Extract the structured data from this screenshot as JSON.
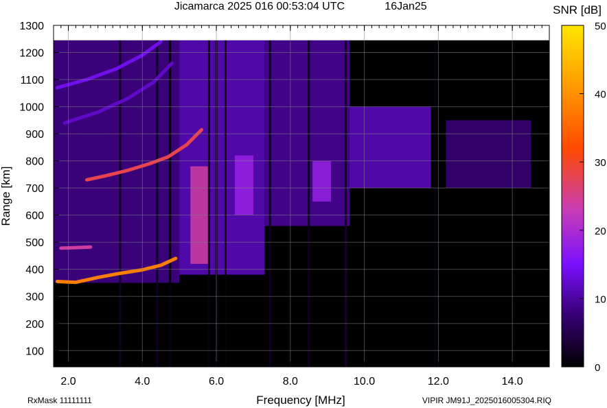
{
  "header": {
    "station_time": "Jicamarca 2025 016 00:53:04 UTC",
    "date": "16Jan25"
  },
  "footer": {
    "rxmask": "RxMask 11111111",
    "file": "VIPIR  JM91J_2025016005304.RIQ"
  },
  "chart_data": {
    "type": "heatmap",
    "xlabel": "Frequency [MHz]",
    "ylabel": "Range [km]",
    "xlim": [
      1.6,
      15.0
    ],
    "ylim": [
      40,
      1300
    ],
    "xticks": [
      2.0,
      4.0,
      6.0,
      8.0,
      10.0,
      12.0,
      14.0
    ],
    "xtick_labels": [
      "2.0",
      "4.0",
      "6.0",
      "8.0",
      "10.0",
      "12.0",
      "14.0"
    ],
    "yticks": [
      100,
      200,
      300,
      400,
      500,
      600,
      700,
      800,
      900,
      1000,
      1100,
      1200,
      1300
    ],
    "ytick_labels": [
      "100",
      "200",
      "300",
      "400",
      "500",
      "600",
      "700",
      "800",
      "900",
      "1000",
      "1100",
      "1200",
      "1300"
    ],
    "data_range_max_km": 1245,
    "grid": true,
    "colorbar": {
      "label": "SNR [dB]",
      "range": [
        0,
        50
      ],
      "ticks": [
        0,
        10,
        20,
        30,
        40,
        50
      ],
      "tick_labels": [
        "0",
        "10",
        "20",
        "30",
        "40",
        "50"
      ],
      "colors": [
        "#000000",
        "#3a007a",
        "#7a10ff",
        "#c83cb4",
        "#ff4a00",
        "#ff9a00",
        "#ffe600"
      ]
    },
    "traces": [
      {
        "name": "o_trace_F",
        "freq": [
          1.7,
          2.2,
          2.8,
          3.4,
          4.0,
          4.5,
          4.9
        ],
        "range": [
          355,
          352,
          370,
          385,
          398,
          415,
          440
        ],
        "snr": 38
      },
      {
        "name": "x_trace_F",
        "freq": [
          2.5,
          3.0,
          3.6,
          4.2,
          4.7,
          5.2,
          5.6
        ],
        "range": [
          730,
          745,
          765,
          790,
          815,
          860,
          915
        ],
        "snr": 28
      },
      {
        "name": "multi_1",
        "freq": [
          1.7,
          2.5,
          3.3,
          4.0,
          4.5
        ],
        "range": [
          1070,
          1100,
          1140,
          1190,
          1240
        ],
        "snr": 14
      },
      {
        "name": "multi_2",
        "freq": [
          1.9,
          2.8,
          3.6,
          4.3,
          4.8
        ],
        "range": [
          940,
          980,
          1030,
          1090,
          1160
        ],
        "snr": 12
      },
      {
        "name": "echo_500",
        "freq": [
          1.8,
          2.2,
          2.6
        ],
        "range": [
          478,
          480,
          482
        ],
        "snr": 24
      }
    ],
    "regions": [
      {
        "freq": [
          1.6,
          5.0
        ],
        "range": [
          350,
          1245
        ],
        "snr": 9
      },
      {
        "freq": [
          5.0,
          7.3
        ],
        "range": [
          380,
          1245
        ],
        "snr": 12
      },
      {
        "freq": [
          7.3,
          9.6
        ],
        "range": [
          560,
          1245
        ],
        "snr": 10
      },
      {
        "freq": [
          9.6,
          11.8
        ],
        "range": [
          700,
          1000
        ],
        "snr": 12
      },
      {
        "freq": [
          12.2,
          14.5
        ],
        "range": [
          700,
          950
        ],
        "snr": 8
      },
      {
        "freq": [
          5.3,
          5.8
        ],
        "range": [
          420,
          780
        ],
        "snr": 24
      },
      {
        "freq": [
          6.5,
          7.0
        ],
        "range": [
          600,
          820
        ],
        "snr": 18
      },
      {
        "freq": [
          8.6,
          9.1
        ],
        "range": [
          650,
          800
        ],
        "snr": 18
      }
    ],
    "vertical_lines": [
      {
        "freq": 3.4,
        "snr": 2
      },
      {
        "freq": 4.4,
        "snr": 2
      },
      {
        "freq": 4.75,
        "snr": 1
      },
      {
        "freq": 5.8,
        "snr": 1
      },
      {
        "freq": 6.0,
        "snr": 1
      },
      {
        "freq": 6.25,
        "snr": 1
      },
      {
        "freq": 7.45,
        "snr": 2
      },
      {
        "freq": 8.5,
        "snr": 2
      },
      {
        "freq": 9.5,
        "snr": 3
      },
      {
        "freq": 11.9,
        "snr": 1
      }
    ]
  }
}
